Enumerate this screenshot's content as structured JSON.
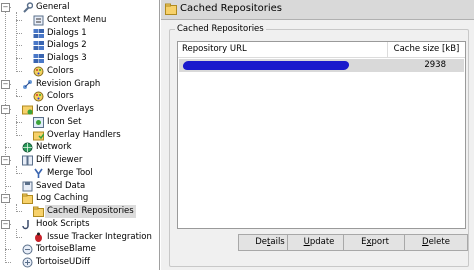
{
  "tree": {
    "items": [
      {
        "id": "general",
        "label": "General",
        "level": 0,
        "expander": "-",
        "icon": "wrench-icon"
      },
      {
        "id": "context-menu",
        "label": "Context Menu",
        "level": 1,
        "icon": "context-menu-icon"
      },
      {
        "id": "dialogs-1",
        "label": "Dialogs 1",
        "level": 1,
        "icon": "dialog-icon"
      },
      {
        "id": "dialogs-2",
        "label": "Dialogs 2",
        "level": 1,
        "icon": "dialog-icon"
      },
      {
        "id": "dialogs-3",
        "label": "Dialogs 3",
        "level": 1,
        "icon": "dialog-icon"
      },
      {
        "id": "colors-1",
        "label": "Colors",
        "level": 1,
        "icon": "palette-icon"
      },
      {
        "id": "revision-graph",
        "label": "Revision Graph",
        "level": 0,
        "expander": "-",
        "icon": "graph-icon"
      },
      {
        "id": "colors-2",
        "label": "Colors",
        "level": 1,
        "icon": "palette-icon"
      },
      {
        "id": "icon-overlays",
        "label": "Icon Overlays",
        "level": 0,
        "expander": "-",
        "icon": "overlay-icon"
      },
      {
        "id": "icon-set",
        "label": "Icon Set",
        "level": 1,
        "icon": "icon-set-icon"
      },
      {
        "id": "overlay-handlers",
        "label": "Overlay Handlers",
        "level": 1,
        "icon": "overlay-handler-icon"
      },
      {
        "id": "network",
        "label": "Network",
        "level": 0,
        "icon": "network-icon"
      },
      {
        "id": "diff-viewer",
        "label": "Diff Viewer",
        "level": 0,
        "expander": "-",
        "icon": "diff-icon"
      },
      {
        "id": "merge-tool",
        "label": "Merge Tool",
        "level": 1,
        "icon": "merge-icon"
      },
      {
        "id": "saved-data",
        "label": "Saved Data",
        "level": 0,
        "icon": "saved-data-icon"
      },
      {
        "id": "log-caching",
        "label": "Log Caching",
        "level": 0,
        "expander": "-",
        "icon": "folder-icon"
      },
      {
        "id": "cached-repositories",
        "label": "Cached Repositories",
        "level": 1,
        "icon": "folder-icon",
        "selected": true
      },
      {
        "id": "hook-scripts",
        "label": "Hook Scripts",
        "level": 0,
        "expander": "-",
        "icon": "hook-icon"
      },
      {
        "id": "issue-tracker",
        "label": "Issue Tracker Integration",
        "level": 1,
        "icon": "bug-icon"
      },
      {
        "id": "tortoiseblame",
        "label": "TortoiseBlame",
        "level": 0,
        "icon": "blame-icon"
      },
      {
        "id": "tortoiseudiff",
        "label": "TortoiseUDiff",
        "level": 0,
        "icon": "udiff-icon"
      }
    ]
  },
  "page": {
    "title": "Cached Repositories",
    "group_label": "Cached Repositories",
    "columns": {
      "url": "Repository URL",
      "size": "Cache size [kB]"
    },
    "rows": [
      {
        "url": "[redacted]",
        "size": "2938"
      }
    ],
    "buttons": {
      "details": {
        "pre": "De",
        "mn": "t",
        "post": "ails"
      },
      "update": {
        "pre": "",
        "mn": "U",
        "post": "pdate"
      },
      "export": {
        "pre": "E",
        "mn": "x",
        "post": "port"
      },
      "delete": {
        "pre": "",
        "mn": "D",
        "post": "elete"
      }
    }
  },
  "colors": {
    "redaction": "#1a1acc",
    "selection": "#d9d9d9",
    "title_bar": "#d9d9d9"
  }
}
